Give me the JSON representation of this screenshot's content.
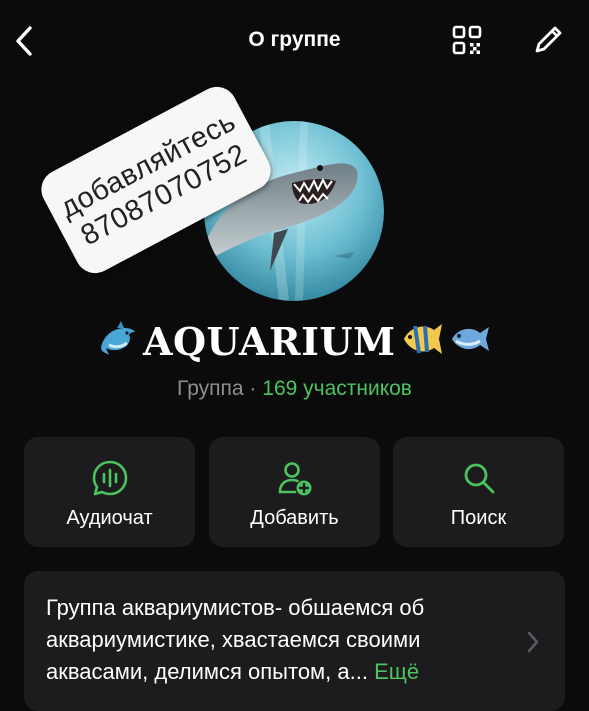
{
  "header": {
    "title": "О группе"
  },
  "sticker": {
    "line1": "добавляйтесь",
    "line2": "87087070752"
  },
  "group": {
    "name_prefix_emoji": "🐬",
    "name": "AQUARIUM",
    "name_suffix_emoji_1": "🐠",
    "name_suffix_emoji_2": "🐟",
    "type": "Группа",
    "separator": " · ",
    "members": "169 участников"
  },
  "actions": [
    {
      "label": "Аудиочат",
      "icon": "audio-chat-icon"
    },
    {
      "label": "Добавить",
      "icon": "add-member-icon"
    },
    {
      "label": "Поиск",
      "icon": "search-icon"
    }
  ],
  "description": {
    "text": "Группа аквариумистов- обшаемся об аквариумистике, хвастаемся своими аквасами, делимся опытом, а...",
    "more": "Ещё"
  },
  "colors": {
    "background": "#0b0b0b",
    "card": "#1c1c1e",
    "accent": "#4cc35e",
    "secondary_text": "#8e8e93"
  }
}
